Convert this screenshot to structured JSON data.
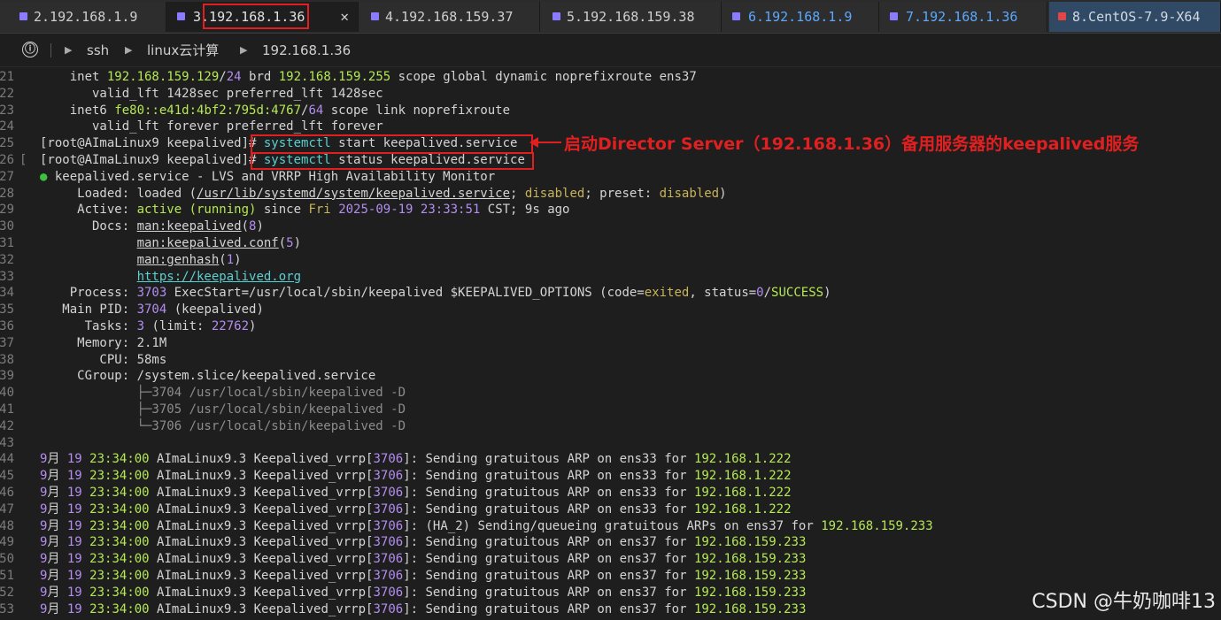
{
  "tabs": [
    {
      "label": "2.192.168.1.9",
      "close": ""
    },
    {
      "label": "3.192.168.1.36",
      "close": "✕"
    },
    {
      "label": "4.192.168.159.37"
    },
    {
      "label": "5.192.168.159.38"
    },
    {
      "label": "6.192.168.1.9"
    },
    {
      "label": "7.192.168.1.36"
    },
    {
      "label": "8.CentOS-7.9-X64"
    }
  ],
  "breadcrumb": {
    "info_icon": "ⓘ",
    "items": [
      "ssh",
      "linux云计算",
      "192.168.1.36"
    ]
  },
  "lines": [
    {
      "n": "21",
      "html": "    inet <span class=\"g\">192.168.159.129</span>/<span class=\"pu\">24</span> brd <span class=\"g\">192.168.159.255</span> scope global dynamic noprefixroute ens37"
    },
    {
      "n": "22",
      "html": "       valid_lft 1428sec preferred_lft 1428sec"
    },
    {
      "n": "23",
      "html": "    inet6 <span class=\"g\">fe80::e41d:4bf2:795d:4767</span>/<span class=\"pu\">64</span> scope link noprefixroute"
    },
    {
      "n": "24",
      "html": "       valid_lft forever preferred_lft forever"
    },
    {
      "n": "25",
      "html": "[root@AImaLinux9 keepalived]# <span class=\"cy\">systemctl</span> start keepalived.service"
    },
    {
      "n": "26",
      "fold": "[",
      "html": "[root@AImaLinux9 keepalived]# <span class=\"cy\">systemctl</span> status keepalived.service"
    },
    {
      "n": "27",
      "html": "<span class=\"dot\">●</span> keepalived.service - LVS and VRRP High Availability Monitor"
    },
    {
      "n": "28",
      "html": "     Loaded: loaded (<span class=\"u\">/usr/lib/systemd/system/keepalived.service</span>; <span class=\"y\">disabled</span>; preset: <span class=\"y\">disabled</span>)"
    },
    {
      "n": "29",
      "html": "     Active: <span class=\"g\">active (running)</span> since <span class=\"y\">Fri</span> <span class=\"pu\">2025-09-19 23:33:51</span> CST; 9s ago"
    },
    {
      "n": "30",
      "html": "       Docs: <span class=\"u\">man:keepalived</span>(<span class=\"pu\">8</span>)"
    },
    {
      "n": "31",
      "html": "             <span class=\"u\">man:keepalived.conf</span>(<span class=\"pu\">5</span>)"
    },
    {
      "n": "32",
      "html": "             <span class=\"u\">man:genhash</span>(<span class=\"pu\">1</span>)"
    },
    {
      "n": "33",
      "html": "             <span class=\"u cy\">https://keepalived.org</span>"
    },
    {
      "n": "34",
      "html": "    Process: <span class=\"pu\">3703</span> ExecStart=/usr/local/sbin/keepalived $KEEPALIVED_OPTIONS (code=<span class=\"y\">exited</span>, status=<span class=\"pu\">0</span>/<span class=\"g\">SUCCESS</span>)"
    },
    {
      "n": "35",
      "html": "   Main PID: <span class=\"pu\">3704</span> (keepalived)"
    },
    {
      "n": "36",
      "html": "      Tasks: <span class=\"pu\">3</span> (limit: <span class=\"pu\">22762</span>)"
    },
    {
      "n": "37",
      "html": "     Memory: 2.1M"
    },
    {
      "n": "38",
      "html": "        CPU: 58ms"
    },
    {
      "n": "39",
      "html": "     CGroup: /system.slice/keepalived.service"
    },
    {
      "n": "40",
      "html": "             <span class=\"dim\">├─3704 /usr/local/sbin/keepalived -D</span>"
    },
    {
      "n": "41",
      "html": "             <span class=\"dim\">├─3705 /usr/local/sbin/keepalived -D</span>"
    },
    {
      "n": "42",
      "html": "             <span class=\"dim\">└─3706 /usr/local/sbin/keepalived -D</span>"
    },
    {
      "n": "43",
      "html": ""
    },
    {
      "n": "44",
      "html": "<span class=\"pu\">9</span>月 <span class=\"pu\">19</span> <span class=\"g\">23:34:00</span> AImaLinux9.3 Keepalived_vrrp[<span class=\"pu\">3706</span>]: Sending gratuitous ARP on ens33 for <span class=\"g\">192.168.1.222</span>"
    },
    {
      "n": "45",
      "html": "<span class=\"pu\">9</span>月 <span class=\"pu\">19</span> <span class=\"g\">23:34:00</span> AImaLinux9.3 Keepalived_vrrp[<span class=\"pu\">3706</span>]: Sending gratuitous ARP on ens33 for <span class=\"g\">192.168.1.222</span>"
    },
    {
      "n": "46",
      "html": "<span class=\"pu\">9</span>月 <span class=\"pu\">19</span> <span class=\"g\">23:34:00</span> AImaLinux9.3 Keepalived_vrrp[<span class=\"pu\">3706</span>]: Sending gratuitous ARP on ens33 for <span class=\"g\">192.168.1.222</span>"
    },
    {
      "n": "47",
      "html": "<span class=\"pu\">9</span>月 <span class=\"pu\">19</span> <span class=\"g\">23:34:00</span> AImaLinux9.3 Keepalived_vrrp[<span class=\"pu\">3706</span>]: Sending gratuitous ARP on ens33 for <span class=\"g\">192.168.1.222</span>"
    },
    {
      "n": "48",
      "html": "<span class=\"pu\">9</span>月 <span class=\"pu\">19</span> <span class=\"g\">23:34:00</span> AImaLinux9.3 Keepalived_vrrp[<span class=\"pu\">3706</span>]: (HA_2) Sending/queueing gratuitous ARPs on ens37 for <span class=\"g\">192.168.159.233</span>"
    },
    {
      "n": "49",
      "html": "<span class=\"pu\">9</span>月 <span class=\"pu\">19</span> <span class=\"g\">23:34:00</span> AImaLinux9.3 Keepalived_vrrp[<span class=\"pu\">3706</span>]: Sending gratuitous ARP on ens37 for <span class=\"g\">192.168.159.233</span>"
    },
    {
      "n": "50",
      "html": "<span class=\"pu\">9</span>月 <span class=\"pu\">19</span> <span class=\"g\">23:34:00</span> AImaLinux9.3 Keepalived_vrrp[<span class=\"pu\">3706</span>]: Sending gratuitous ARP on ens37 for <span class=\"g\">192.168.159.233</span>"
    },
    {
      "n": "51",
      "html": "<span class=\"pu\">9</span>月 <span class=\"pu\">19</span> <span class=\"g\">23:34:00</span> AImaLinux9.3 Keepalived_vrrp[<span class=\"pu\">3706</span>]: Sending gratuitous ARP on ens37 for <span class=\"g\">192.168.159.233</span>"
    },
    {
      "n": "52",
      "html": "<span class=\"pu\">9</span>月 <span class=\"pu\">19</span> <span class=\"g\">23:34:00</span> AImaLinux9.3 Keepalived_vrrp[<span class=\"pu\">3706</span>]: Sending gratuitous ARP on ens37 for <span class=\"g\">192.168.159.233</span>"
    },
    {
      "n": "53",
      "html": "<span class=\"pu\">9</span>月 <span class=\"pu\">19</span> <span class=\"g\">23:34:00</span> AImaLinux9.3 Keepalived_vrrp[<span class=\"pu\">3706</span>]: Sending gratuitous ARP on ens37 for <span class=\"g\">192.168.159.233</span>"
    }
  ],
  "annotation": "启动Director Server（192.168.1.36）备用服务器的keepalived服务",
  "watermark": "CSDN @牛奶咖啡13",
  "colors": {
    "annotation": "#e02020",
    "tab_icon": "#8b7cff",
    "centos_icon": "#e24545"
  }
}
